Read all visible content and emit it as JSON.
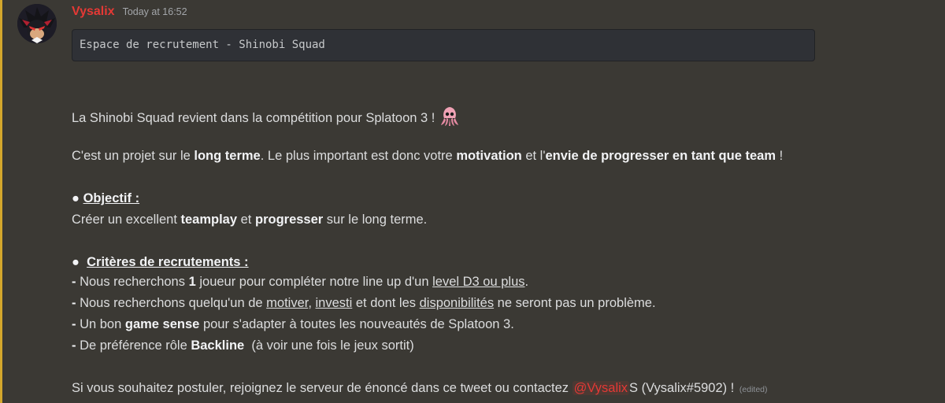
{
  "author": {
    "name": "Vysalix",
    "timestamp": "Today at 16:52",
    "avatar_icon": "hedgehog-avatar-icon"
  },
  "code_block": "Espace de recrutement - Shinobi Squad",
  "intro": {
    "text": "La Shinobi Squad revient dans la compétition pour Splatoon 3 !",
    "emoji": "squid-emoji-icon"
  },
  "project": {
    "p1": "C'est un projet sur le ",
    "b1": "long terme",
    "p2": ". Le plus important est donc votre ",
    "b2": "motivation",
    "p3": " et l'",
    "b3": "envie de progresser en tant que team",
    "p4": " !"
  },
  "objective": {
    "bullet": "●",
    "heading": "Objectif :",
    "p1": "Créer un excellent ",
    "b1": "teamplay",
    "p2": " et ",
    "b2": "progresser",
    "p3": " sur le long terme."
  },
  "criteria": {
    "bullet": "●",
    "heading": "Critères de recrutements  :",
    "dash": "-",
    "item1": {
      "p1": " Nous recherchons ",
      "b1": "1",
      "p2": " joueur pour compléter notre line up d'un ",
      "u1": "level D3 ou plus",
      "p3": "."
    },
    "item2": {
      "p1": " Nous recherchons quelqu'un de ",
      "u1": "motiver",
      "p2": ", ",
      "u2": "investi",
      "p3": " et dont les ",
      "u3": "disponibilités",
      "p4": " ne seront pas un problème."
    },
    "item3": {
      "p1": " Un bon ",
      "b1": "game sense",
      "p2": " pour s'adapter à toutes les nouveautés de Splatoon 3."
    },
    "item4": {
      "p1": " De préférence rôle ",
      "b1": "Backline",
      "p2": "  (à voir une fois le jeux sortit)"
    }
  },
  "closing": {
    "p1": "Si vous souhaitez postuler, rejoignez le serveur de énoncé dans ce tweet ou contactez ",
    "mention": "@Vysalix",
    "p2": "S (Vysalix#5902) !",
    "edited": "(edited)"
  },
  "colors": {
    "background": "#3b3934",
    "accent_border": "#d4a72c",
    "username": "#e53935",
    "text": "#dcddde"
  }
}
